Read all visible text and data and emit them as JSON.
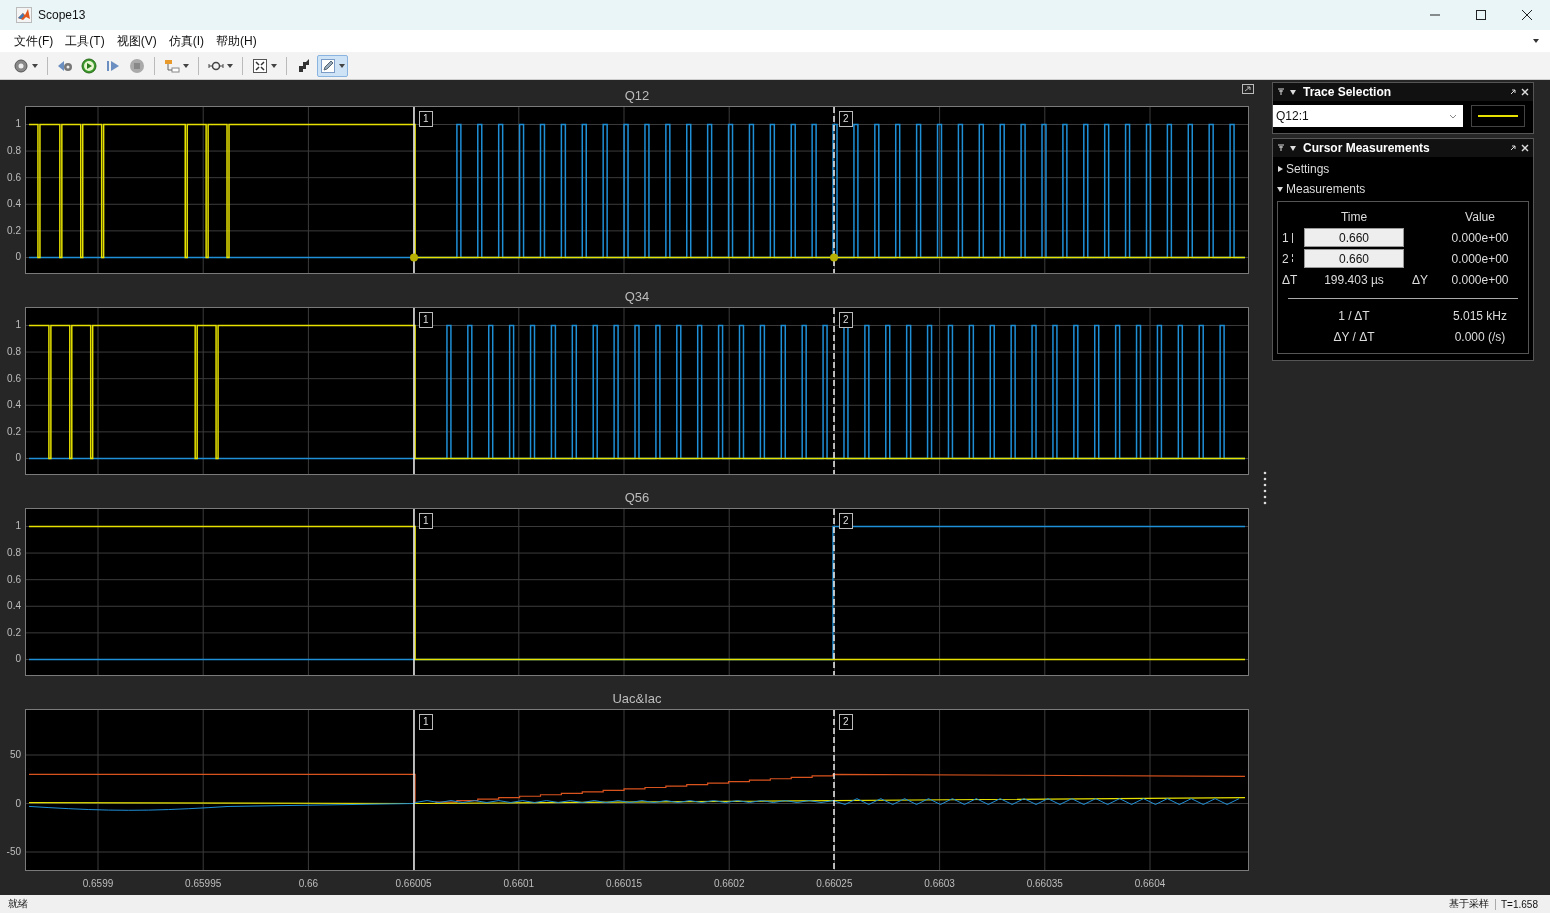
{
  "window": {
    "title": "Scope13"
  },
  "menu": [
    "文件(F)",
    "工具(T)",
    "视图(V)",
    "仿真(I)",
    "帮助(H)"
  ],
  "toolbar": [
    [
      {
        "kind": "settings",
        "dropdown": true,
        "selected": false
      }
    ],
    [
      {
        "kind": "step-back",
        "dropdown": false,
        "selected": false
      },
      {
        "kind": "run",
        "dropdown": false,
        "selected": false
      },
      {
        "kind": "step-forward",
        "dropdown": false,
        "selected": false
      },
      {
        "kind": "stop",
        "dropdown": false,
        "selected": false
      }
    ],
    [
      {
        "kind": "highlight",
        "dropdown": true,
        "selected": false
      }
    ],
    [
      {
        "kind": "zoom",
        "dropdown": true,
        "selected": false
      }
    ],
    [
      {
        "kind": "fit",
        "dropdown": true,
        "selected": false
      }
    ],
    [
      {
        "kind": "bring",
        "dropdown": false,
        "selected": false
      },
      {
        "kind": "edit",
        "dropdown": true,
        "selected": true
      }
    ]
  ],
  "plots": [
    {
      "title": "Q12",
      "kind": "digital",
      "yticks": [
        "1",
        "0.8",
        "0.6",
        "0.4",
        "0.2",
        "0"
      ],
      "cursors": [
        "1",
        "2"
      ]
    },
    {
      "title": "Q34",
      "kind": "digital",
      "yticks": [
        "1",
        "0.8",
        "0.6",
        "0.4",
        "0.2",
        "0"
      ],
      "cursors": [
        "1",
        "2"
      ]
    },
    {
      "title": "Q56",
      "kind": "digital",
      "yticks": [
        "1",
        "0.8",
        "0.6",
        "0.4",
        "0.2",
        "0"
      ],
      "cursors": [
        "1",
        "2"
      ]
    },
    {
      "title": "Uac&Iac",
      "kind": "analog",
      "yticks": [
        "50",
        "0",
        "-50"
      ],
      "cursors": [
        "1",
        "2"
      ]
    }
  ],
  "xticks": [
    "0.6599",
    "0.65995",
    "0.66",
    "0.66005",
    "0.6601",
    "0.66015",
    "0.6602",
    "0.66025",
    "0.6603",
    "0.66035",
    "0.6604"
  ],
  "trace_selection": {
    "title": "Trace Selection",
    "value": "Q12:1"
  },
  "cursor_measurements": {
    "title": "Cursor Measurements",
    "sections": [
      {
        "label": "Settings",
        "expanded": false
      },
      {
        "label": "Measurements",
        "expanded": true
      }
    ],
    "headers": [
      "Time",
      "Value"
    ],
    "cursors": [
      {
        "label": "1",
        "time": "0.660",
        "value": "0.000e+00"
      },
      {
        "label": "2",
        "time": "0.660",
        "value": "0.000e+00"
      }
    ],
    "delta": {
      "dt_label": "ΔT",
      "dt": "199.403 µs",
      "dy_label": "ΔY",
      "dy": "0.000e+00"
    },
    "derived": [
      {
        "label": "1 / ΔT",
        "value": "5.015 kHz"
      },
      {
        "label": "ΔY / ΔT",
        "value": "0.000 (/s)"
      }
    ]
  },
  "status_bar": {
    "left": "就绪",
    "mode": "基于采样",
    "time": "T=1.658"
  }
}
